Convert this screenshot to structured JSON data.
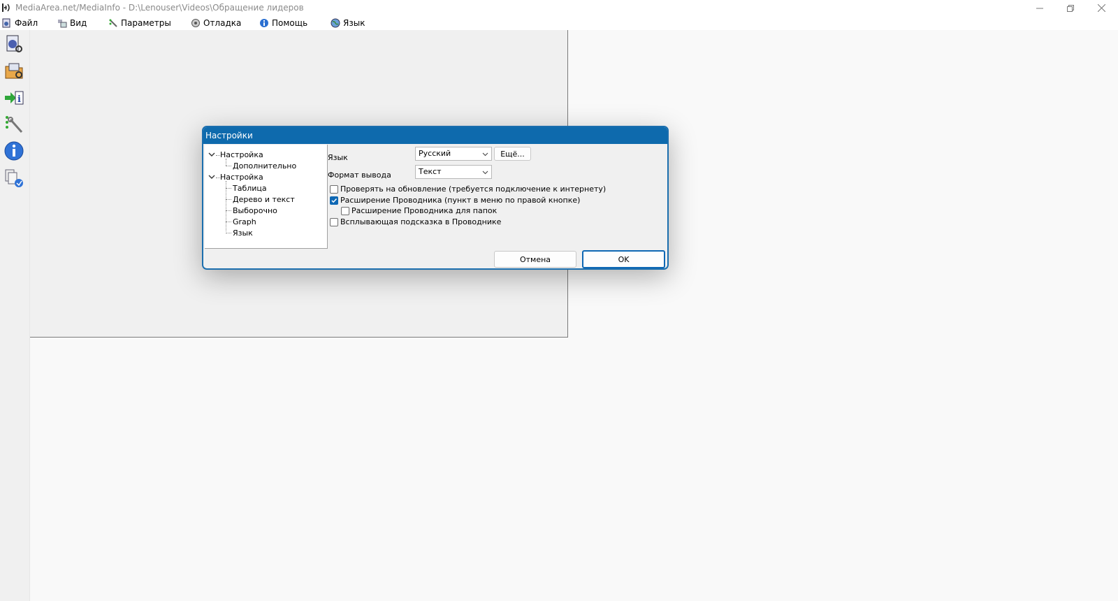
{
  "window": {
    "title": "MediaArea.net/MediaInfo - D:\\Lenouser\\Videos\\Обращение лидеров"
  },
  "menu": {
    "items": [
      {
        "label": "Файл",
        "icon": "file-media-icon"
      },
      {
        "label": "Вид",
        "icon": "view-icon"
      },
      {
        "label": "Параметры",
        "icon": "settings-tools-icon"
      },
      {
        "label": "Отладка",
        "icon": "debug-icon"
      },
      {
        "label": "Помощь",
        "icon": "help-info-icon"
      },
      {
        "label": "Язык",
        "icon": "globe-icon"
      }
    ]
  },
  "toolbar": {
    "items": [
      "open-file-icon",
      "open-folder-icon",
      "export-icon",
      "preferences-icon",
      "about-icon",
      "knowledge-base-icon"
    ]
  },
  "dialog": {
    "title": "Настройки",
    "tree": [
      {
        "label": "Настройка"
      },
      {
        "label": "Дополнительно"
      },
      {
        "label": "Настройка"
      },
      {
        "label": "Таблица"
      },
      {
        "label": "Дерево и текст"
      },
      {
        "label": "Выборочно"
      },
      {
        "label": "Graph"
      },
      {
        "label": "Язык"
      }
    ],
    "language_label": "Язык",
    "language_value": "Русский",
    "more_button": "Ещё...",
    "output_label": "Формат вывода",
    "output_value": "Текст",
    "checkboxes": [
      {
        "label": "Проверять на обновление (требуется подключение к интернету)",
        "checked": false
      },
      {
        "label": "Расширение Проводника (пункт в меню по правой кнопке)",
        "checked": true
      },
      {
        "label": "Расширение Проводника для папок",
        "checked": false
      },
      {
        "label": "Всплывающая подсказка в Проводнике",
        "checked": false
      }
    ],
    "cancel_button": "Отмена",
    "ok_button": "OK"
  },
  "colors": {
    "accent": "#0e6aad",
    "dialog_bg": "#f0f0f0"
  }
}
